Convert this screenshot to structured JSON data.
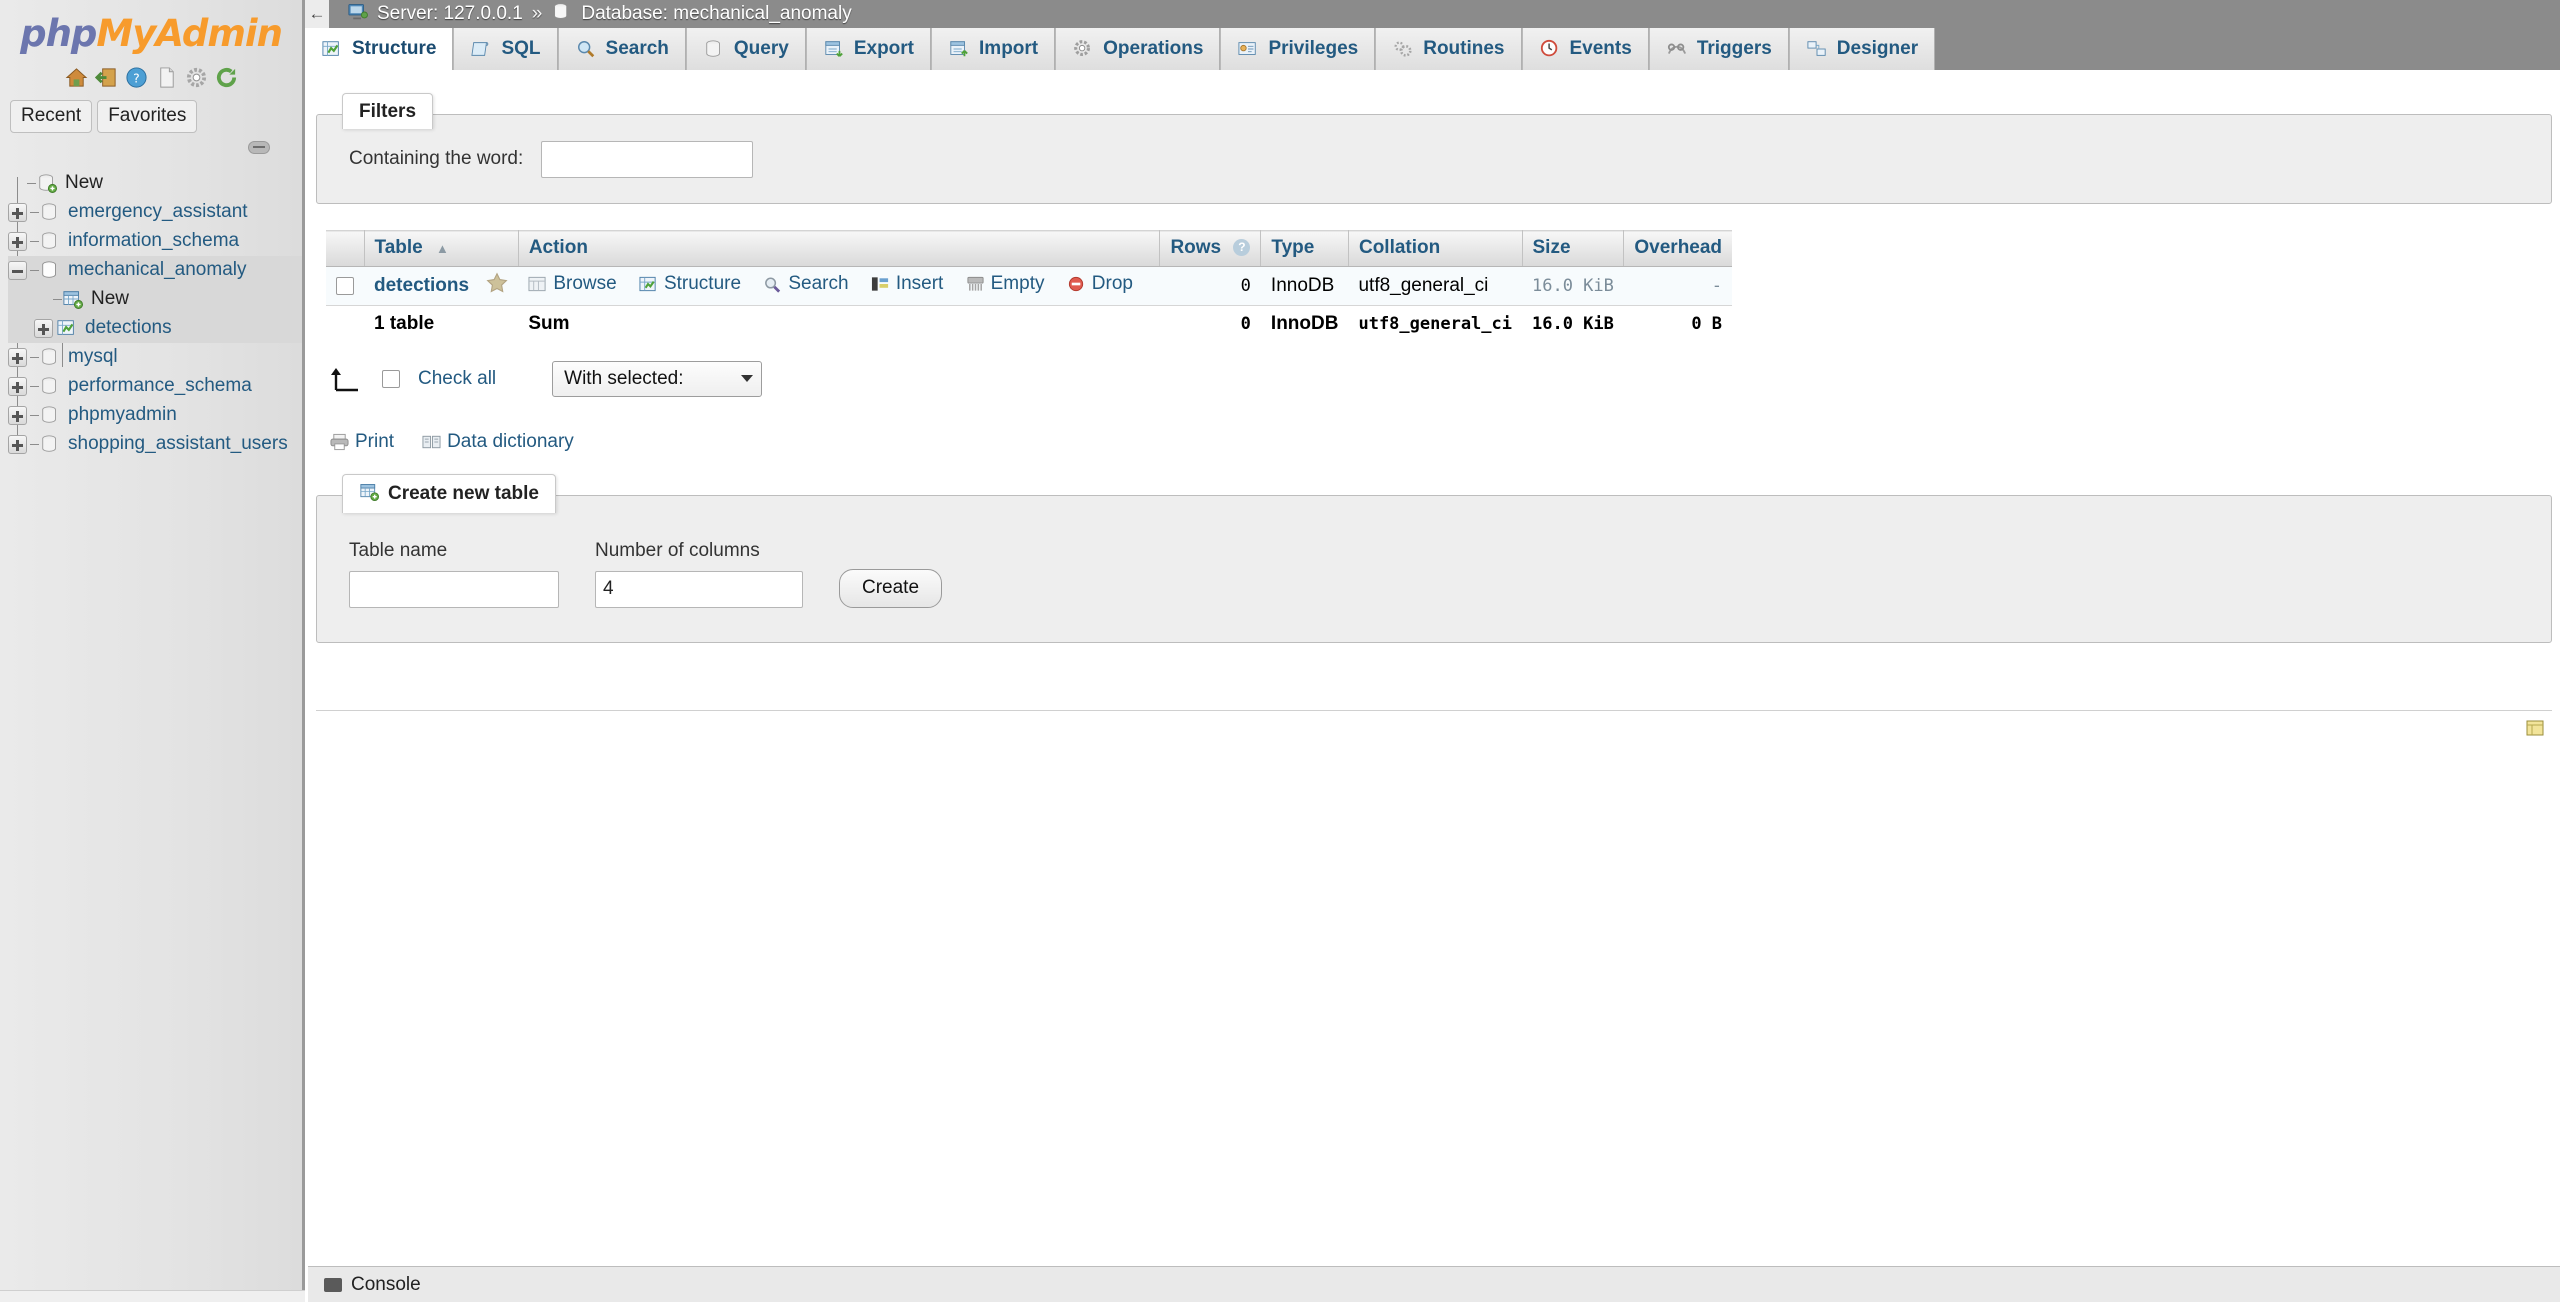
{
  "brand": {
    "part1": "php",
    "part2": "MyAdmin"
  },
  "logo_icons": [
    {
      "name": "home-icon"
    },
    {
      "name": "logout-icon"
    },
    {
      "name": "help-icon"
    },
    {
      "name": "docs-icon"
    },
    {
      "name": "settings-icon"
    },
    {
      "name": "reload-icon"
    }
  ],
  "quick_tabs": [
    {
      "label": "Recent"
    },
    {
      "label": "Favorites"
    }
  ],
  "db_tree": [
    {
      "label": "New",
      "icon": "database-new-icon",
      "expander": "none",
      "depth": 0,
      "highlight": false,
      "link": false
    },
    {
      "label": "emergency_assistant",
      "icon": "database-icon",
      "expander": "plus",
      "depth": 0,
      "highlight": false,
      "link": true
    },
    {
      "label": "information_schema",
      "icon": "database-icon",
      "expander": "plus",
      "depth": 0,
      "highlight": false,
      "link": true
    },
    {
      "label": "mechanical_anomaly",
      "icon": "database-icon",
      "expander": "minus",
      "depth": 0,
      "highlight": true,
      "link": true
    },
    {
      "label": "New",
      "icon": "table-new-icon",
      "expander": "none",
      "depth": 1,
      "highlight": true,
      "link": false
    },
    {
      "label": "detections",
      "icon": "table-icon",
      "expander": "plus",
      "depth": 1,
      "highlight": true,
      "link": true
    },
    {
      "label": "mysql",
      "icon": "database-icon",
      "expander": "plus",
      "depth": 0,
      "highlight": false,
      "link": true
    },
    {
      "label": "performance_schema",
      "icon": "database-icon",
      "expander": "plus",
      "depth": 0,
      "highlight": false,
      "link": true
    },
    {
      "label": "phpmyadmin",
      "icon": "database-icon",
      "expander": "plus",
      "depth": 0,
      "highlight": false,
      "link": true
    },
    {
      "label": "shopping_assistant_users",
      "icon": "database-icon",
      "expander": "plus",
      "depth": 0,
      "highlight": false,
      "link": true
    }
  ],
  "breadcrumb": {
    "back": "←",
    "server_label": "Server: 127.0.0.1",
    "separator": "»",
    "database_label": "Database: mechanical_anomaly"
  },
  "tabs": [
    {
      "label": "Structure",
      "icon": "structure-icon",
      "active": true
    },
    {
      "label": "SQL",
      "icon": "sql-icon",
      "active": false
    },
    {
      "label": "Search",
      "icon": "search-icon",
      "active": false
    },
    {
      "label": "Query",
      "icon": "query-icon",
      "active": false
    },
    {
      "label": "Export",
      "icon": "export-icon",
      "active": false
    },
    {
      "label": "Import",
      "icon": "import-icon",
      "active": false
    },
    {
      "label": "Operations",
      "icon": "operations-icon",
      "active": false
    },
    {
      "label": "Privileges",
      "icon": "privileges-icon",
      "active": false
    },
    {
      "label": "Routines",
      "icon": "routines-icon",
      "active": false
    },
    {
      "label": "Events",
      "icon": "events-icon",
      "active": false
    },
    {
      "label": "Triggers",
      "icon": "triggers-icon",
      "active": false
    },
    {
      "label": "Designer",
      "icon": "designer-icon",
      "active": false
    }
  ],
  "filters": {
    "legend": "Filters",
    "word_label": "Containing the word:",
    "word_value": "",
    "word_placeholder": ""
  },
  "table_list": {
    "headers": [
      "",
      "Table",
      "Action",
      "Rows",
      "Type",
      "Collation",
      "Size",
      "Overhead"
    ],
    "sort_indicator": "▲",
    "rows_help": "?",
    "rows": [
      {
        "name": "detections",
        "favorite": "star-icon",
        "actions": [
          {
            "label": "Browse",
            "icon": "browse-icon"
          },
          {
            "label": "Structure",
            "icon": "structure-icon"
          },
          {
            "label": "Search",
            "icon": "search-icon"
          },
          {
            "label": "Insert",
            "icon": "insert-icon"
          },
          {
            "label": "Empty",
            "icon": "empty-icon"
          },
          {
            "label": "Drop",
            "icon": "drop-icon"
          }
        ],
        "rows_count": "0",
        "type": "InnoDB",
        "collation": "utf8_general_ci",
        "size": "16.0 KiB",
        "overhead": "-"
      }
    ],
    "summary": {
      "count_label": "1 table",
      "sum_label": "Sum",
      "rows_count": "0",
      "type": "InnoDB",
      "collation": "utf8_general_ci",
      "size": "16.0 KiB",
      "overhead": "0 B"
    }
  },
  "bulk": {
    "check_all": "Check all",
    "with_selected": "With selected:"
  },
  "footer_links": [
    {
      "label": "Print",
      "icon": "printer-icon"
    },
    {
      "label": "Data dictionary",
      "icon": "data-dictionary-icon"
    }
  ],
  "create_table": {
    "legend": "Create new table",
    "legend_icon": "table-new-icon",
    "table_name_label": "Table name",
    "table_name_value": "",
    "columns_label": "Number of columns",
    "columns_value": "4",
    "create_button": "Create"
  },
  "console": {
    "label": "Console",
    "icon": "console-icon"
  },
  "colors": {
    "brand_blue": "#6c76ae",
    "brand_orange": "#f79b2c",
    "link": "#235a81",
    "header_bar": "#8b8b8b",
    "sidebar_bg": "#e3e3e3",
    "row_bg": "#f7fbfd"
  }
}
